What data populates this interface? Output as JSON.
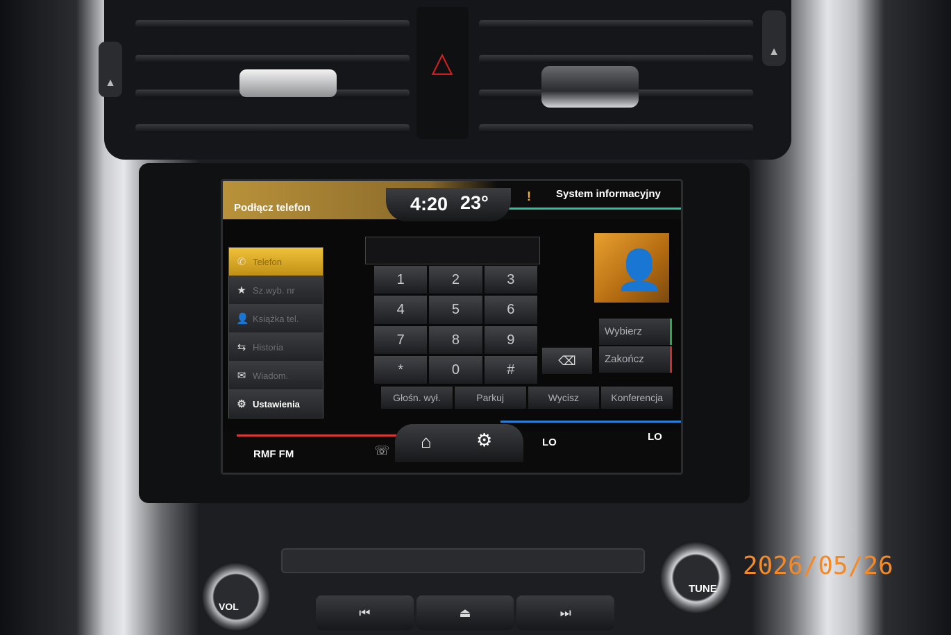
{
  "status_bar": {
    "connect_label": "Podłącz telefon",
    "time": "4:20",
    "temperature": "23°",
    "alert_symbol": "!",
    "system_info": "System informacyjny"
  },
  "side_menu": {
    "items": [
      {
        "label": "Telefon",
        "icon": "phone-icon",
        "glyph": "✆"
      },
      {
        "label": "Sz.wyb. nr",
        "icon": "star-icon",
        "glyph": "★"
      },
      {
        "label": "Książka tel.",
        "icon": "contact-icon",
        "glyph": "👤"
      },
      {
        "label": "Historia",
        "icon": "history-icon",
        "glyph": "⇆"
      },
      {
        "label": "Wiadom.",
        "icon": "messages-icon",
        "glyph": "✉"
      },
      {
        "label": "Ustawienia",
        "icon": "settings-icon",
        "glyph": "⚙"
      }
    ]
  },
  "dialer": {
    "keys": [
      "1",
      "2",
      "3",
      "4",
      "5",
      "6",
      "7",
      "8",
      "9",
      "*",
      "0",
      "#"
    ],
    "backspace_glyph": "⌫",
    "select_label": "Wybierz",
    "end_label": "Zakończ",
    "actions": [
      "Głośn. wył.",
      "Parkuj",
      "Wycisz",
      "Konferencja"
    ]
  },
  "bottom_bar": {
    "radio_station": "RMF FM",
    "phone_glyph": "☏",
    "home_glyph": "⌂",
    "settings_glyph": "⚙",
    "left_climate": "LO",
    "right_climate": "LO"
  },
  "console": {
    "volume_label": "VOL",
    "tune_label": "TUNE",
    "prev_glyph": "⏮",
    "eject_glyph": "⏏",
    "next_glyph": "⏭"
  },
  "hazard_glyph": "△",
  "date_stamp": "2026/05/26",
  "colors": {
    "accent": "#f0c23a",
    "teal": "#28c4a2",
    "red": "#d93838",
    "blue": "#2a7fd8",
    "date": "#f38a2a"
  }
}
